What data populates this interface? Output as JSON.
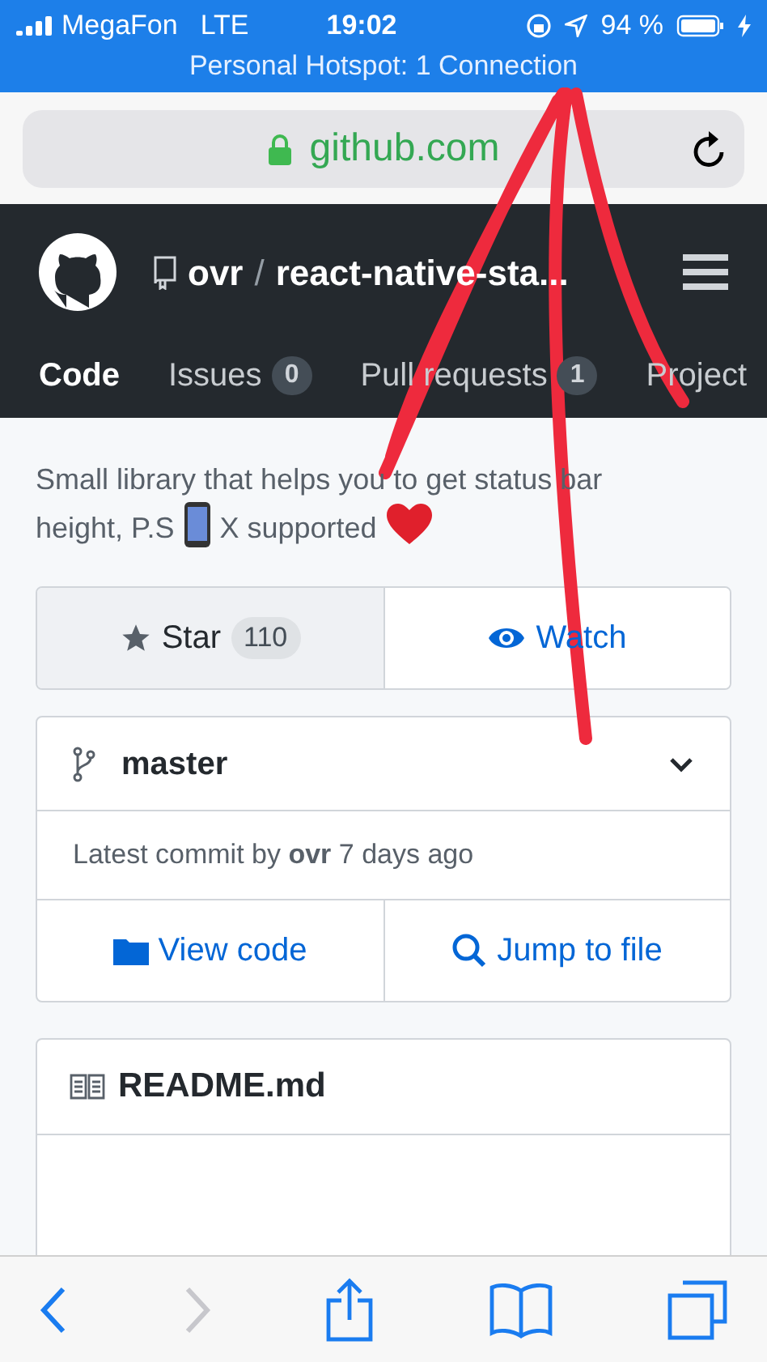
{
  "status_bar": {
    "carrier": "MegaFon",
    "network": "LTE",
    "time": "19:02",
    "battery": "94 %",
    "hotspot": "Personal Hotspot: 1 Connection"
  },
  "address_bar": {
    "url": "github.com"
  },
  "header": {
    "owner": "ovr",
    "separator": "/",
    "repo": "react-native-sta..."
  },
  "tabs": [
    {
      "label": "Code",
      "selected": true
    },
    {
      "label": "Issues",
      "count": "0",
      "selected": false
    },
    {
      "label": "Pull requests",
      "count": "1",
      "selected": false
    },
    {
      "label": "Project",
      "selected": false
    }
  ],
  "description": {
    "line_1": "Small library that helps you to get status bar",
    "text": "height, P.S",
    "after": "X supported"
  },
  "actions": [
    {
      "kind": "star",
      "label": "Star",
      "count": "110"
    },
    {
      "kind": "watch",
      "label": "Watch"
    }
  ],
  "branch": {
    "name": "master",
    "commit": "Latest commit by **ovr** 7 days ago"
  },
  "file_actions": [
    {
      "kind": "folder",
      "label": "View code"
    },
    {
      "kind": "search",
      "label": "Jump to file"
    }
  ],
  "readme": {
    "title": "README.md"
  },
  "toolbar": [
    {
      "kind": "back",
      "disabled": false
    },
    {
      "kind": "forward",
      "disabled": true
    },
    {
      "kind": "share",
      "disabled": false
    },
    {
      "kind": "bookmarks",
      "disabled": false
    },
    {
      "kind": "tabs",
      "disabled": false
    }
  ]
}
